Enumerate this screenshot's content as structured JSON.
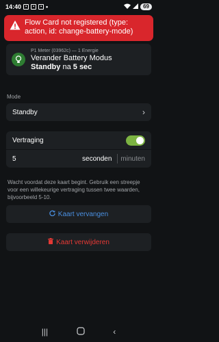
{
  "status_bar": {
    "time": "14:40",
    "battery": "69"
  },
  "error_toast": {
    "message": "Flow Card not registered (type: action, id: change-battery-mode)"
  },
  "card": {
    "device": "P1 Meter (03962c) — 1 Energie",
    "title": "Verander Battery Modus",
    "subtitle_bold": "Standby",
    "subtitle_rest": " na ",
    "subtitle_delay": "5 sec"
  },
  "mode": {
    "label": "Mode",
    "value": "Standby"
  },
  "delay": {
    "label": "Vertraging",
    "enabled": true,
    "value": "5",
    "unit_active": "seconden",
    "unit_inactive": "minuten",
    "help": "Wacht voordat deze kaart begint. Gebruik een streepje voor een willekeurige vertraging tussen twee waarden, bijvoorbeeld 5-10."
  },
  "actions": {
    "replace_label": "Kaart vervangen",
    "delete_label": "Kaart verwijderen"
  },
  "colors": {
    "error": "#d9262c",
    "accent_blue": "#4a8fe0",
    "danger": "#e53935",
    "toggle_on": "#7cb342"
  }
}
